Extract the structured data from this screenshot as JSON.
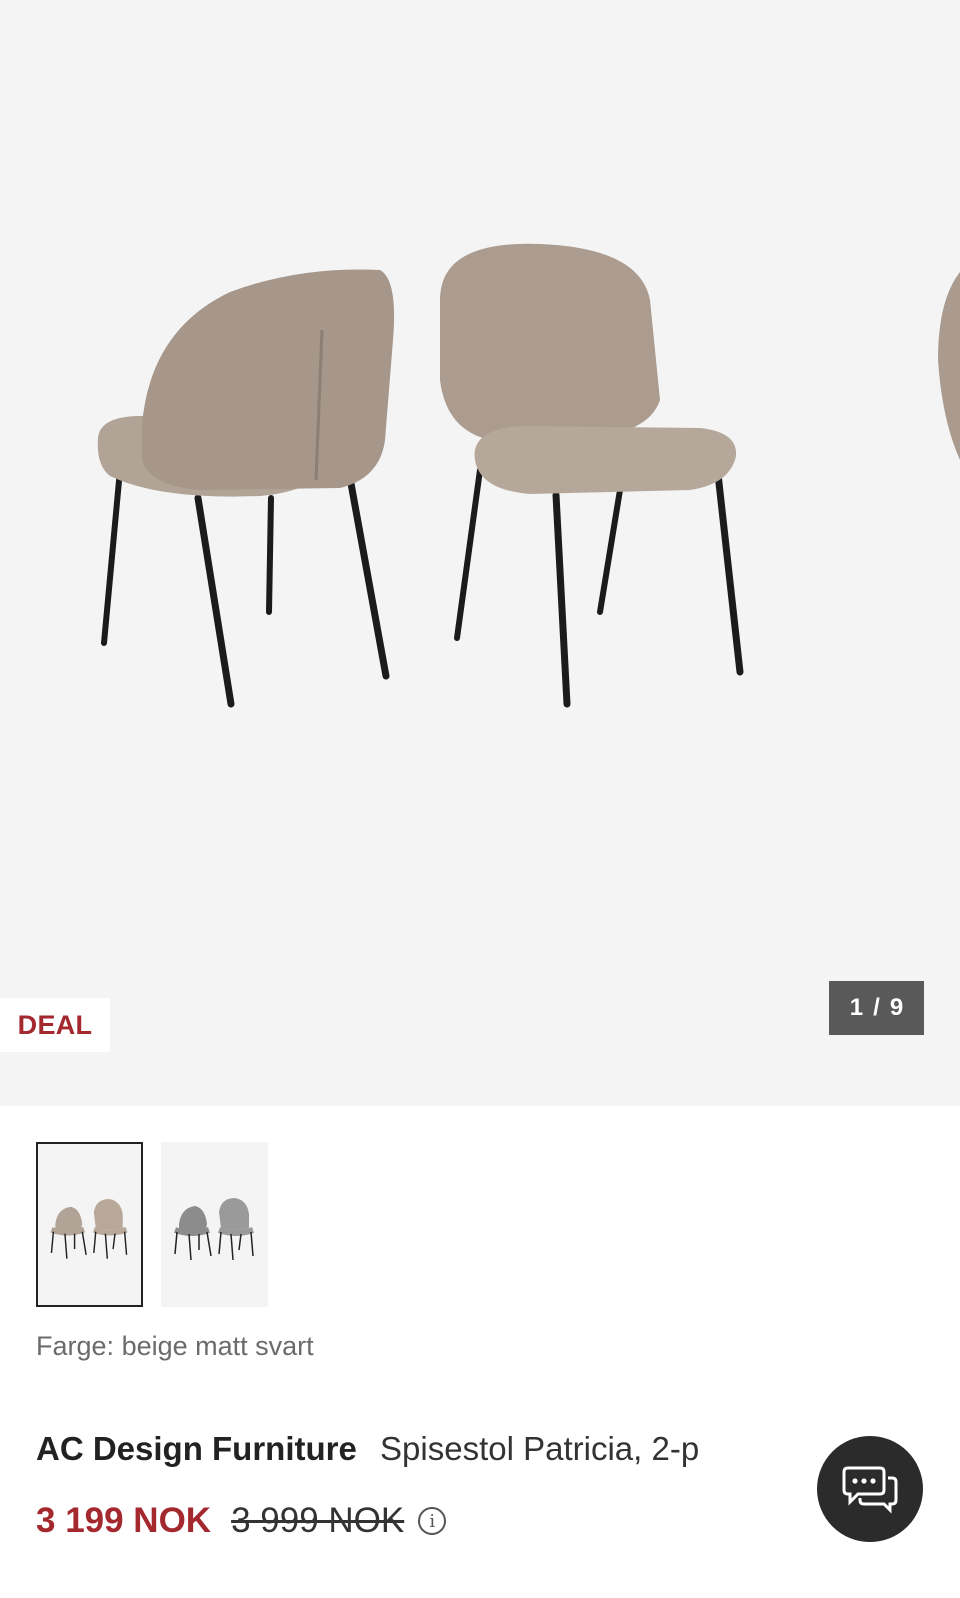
{
  "gallery": {
    "badge": "DEAL",
    "counter_current": "1",
    "counter_sep": "/",
    "counter_total": "9",
    "image_alt": "chairs-photo"
  },
  "thumbnails": [
    {
      "name": "beige",
      "selected": true
    },
    {
      "name": "grey",
      "selected": false
    }
  ],
  "color_selection": {
    "label": "Farge:",
    "value": "beige matt svart"
  },
  "product": {
    "brand": "AC Design Furniture",
    "name": "Spisestol Patricia, 2-p",
    "price_now": "3 199 NOK",
    "price_old": "3 999 NOK"
  },
  "colors": {
    "accent": "#a4292f",
    "background": "#f4f4f5",
    "chat_bg": "#2b2b2b",
    "counter_bg": "#595959"
  },
  "icons": {
    "info": "info-icon",
    "chat": "chat-icon"
  }
}
